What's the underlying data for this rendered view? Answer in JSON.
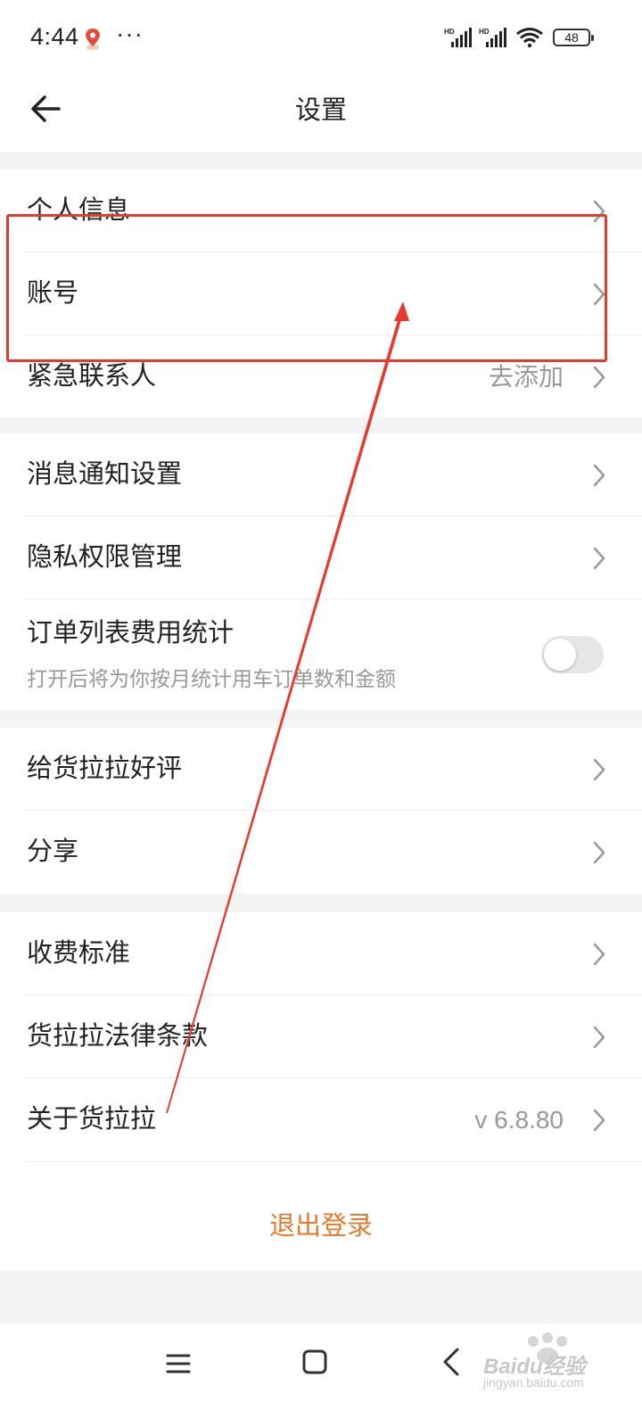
{
  "status_bar": {
    "time": "4:44",
    "battery": "48"
  },
  "header": {
    "title": "设置"
  },
  "groups": {
    "account": {
      "personal_info": "个人信息",
      "account": "账号",
      "emergency_contact": "紧急联系人",
      "emergency_contact_value": "去添加"
    },
    "preferences": {
      "notifications": "消息通知设置",
      "privacy": "隐私权限管理",
      "order_stats": "订单列表费用统计",
      "order_stats_desc": "打开后将为你按月统计用车订单数和金额",
      "order_stats_enabled": false
    },
    "social": {
      "rate": "给货拉拉好评",
      "share": "分享"
    },
    "about": {
      "pricing": "收费标准",
      "legal": "货拉拉法律条款",
      "about": "关于货拉拉",
      "version": "v 6.8.80"
    }
  },
  "logout_label": "退出登录",
  "watermark": {
    "text": "Baidu经验",
    "url": "jingyan.baidu.com"
  },
  "colors": {
    "accent": "#e27b2e",
    "annotation": "#e53b2f"
  }
}
